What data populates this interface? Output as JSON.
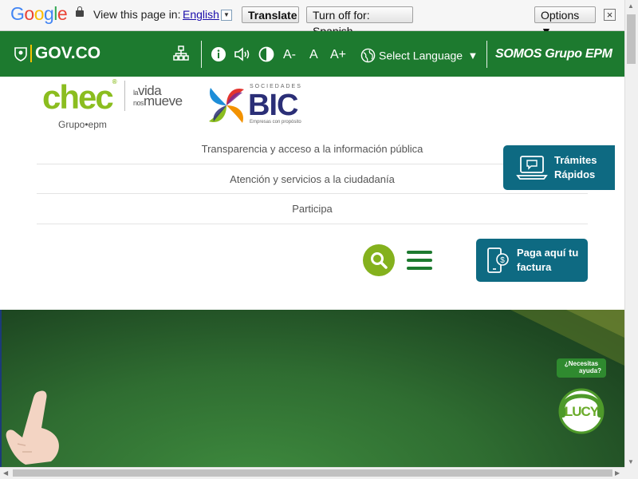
{
  "translate_bar": {
    "logo_letters": [
      {
        "ch": "G",
        "color": "#4285f4"
      },
      {
        "ch": "o",
        "color": "#ea4335"
      },
      {
        "ch": "o",
        "color": "#fbbc05"
      },
      {
        "ch": "g",
        "color": "#4285f4"
      },
      {
        "ch": "l",
        "color": "#34a853"
      },
      {
        "ch": "e",
        "color": "#ea4335"
      }
    ],
    "view_label": "View this page in:",
    "language": "English",
    "language_arrow": "▼",
    "translate_button": "Translate",
    "turn_off_button": "Turn off for: Spanish",
    "options_button": "Options ▼",
    "close_label": "×"
  },
  "gov_bar": {
    "gov_label": "GOV.CO",
    "font_decrease": "A-",
    "font_normal": "A",
    "font_increase": "A+",
    "select_language": "Select Language",
    "select_arrow": "▼",
    "brand": "SOMOS Grupo EPM",
    "color": "#1d7a2f"
  },
  "header": {
    "chec_logo": "chec",
    "chec_tm": "®",
    "grupo_epm": "Grupo•epm",
    "vida_line1_small": "la",
    "vida_line1": "vida",
    "vida_line2_small": "nos",
    "vida_line2": "mueve",
    "sociedades": "SOCIEDADES",
    "bic": "BIC",
    "bic_sub": "Empresas con propósito"
  },
  "nav": {
    "items": [
      {
        "label": "Transparencia y acceso a la información pública"
      },
      {
        "label": "Atención y servicios a la ciudadanía"
      },
      {
        "label": "Participa"
      }
    ]
  },
  "tramites": {
    "line1": "Trámites",
    "line2": "Rápidos"
  },
  "paga": {
    "line1": "Paga aquí tu",
    "line2": "factura"
  },
  "lucy": {
    "bubble_line1": "¿Necesitas",
    "bubble_line2": "ayuda?",
    "name": "LUCY"
  },
  "colors": {
    "primary_green": "#1d7a2f",
    "lime": "#84b11d",
    "teal": "#0e6a82",
    "bic_navy": "#2b2f77"
  }
}
